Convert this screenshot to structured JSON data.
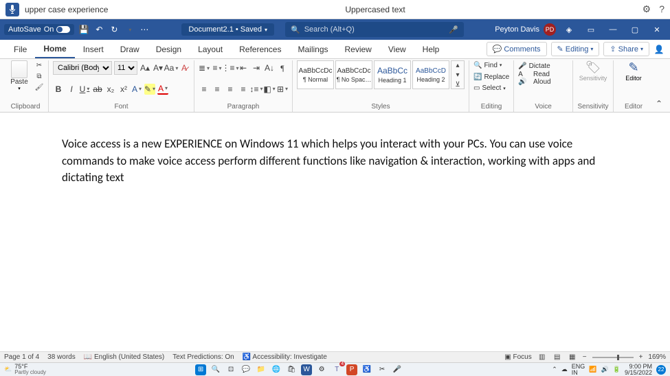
{
  "voice": {
    "command": "upper case experience",
    "feedback": "Uppercased text"
  },
  "titlebar": {
    "autosave_label": "AutoSave",
    "autosave_state": "On",
    "doc_name": "Document2.1 • Saved",
    "search_placeholder": "Search (Alt+Q)",
    "user_name": "Peyton Davis",
    "user_initials": "PD"
  },
  "tabs": {
    "file": "File",
    "home": "Home",
    "insert": "Insert",
    "draw": "Draw",
    "design": "Design",
    "layout": "Layout",
    "references": "References",
    "mailings": "Mailings",
    "review": "Review",
    "view": "View",
    "help": "Help",
    "comments": "Comments",
    "editing": "Editing",
    "share": "Share"
  },
  "ribbon": {
    "paste": "Paste",
    "clipboard": "Clipboard",
    "font_name": "Calibri (Body)",
    "font_size": "11",
    "font_label": "Font",
    "paragraph_label": "Paragraph",
    "styles_label": "Styles",
    "editing_label": "Editing",
    "voice_label": "Voice",
    "sensitivity_label": "Sensitivity",
    "editor_label": "Editor",
    "find": "Find",
    "replace": "Replace",
    "select": "Select",
    "dictate": "Dictate",
    "read_aloud": "Read Aloud",
    "sensitivity_btn": "Sensitivity",
    "editor_btn": "Editor",
    "styles": [
      {
        "sample": "AaBbCcDc",
        "name": "¶ Normal"
      },
      {
        "sample": "AaBbCcDc",
        "name": "¶ No Spac…"
      },
      {
        "sample": "AaBbCc",
        "name": "Heading 1"
      },
      {
        "sample": "AaBbCcD",
        "name": "Heading 2"
      }
    ]
  },
  "document": {
    "body": "Voice access is a new EXPERIENCE on Windows 11 which helps you interact with your PCs. You can use voice commands to make voice access perform different functions like navigation & interaction, working with apps and dictating text"
  },
  "status": {
    "page": "Page 1 of 4",
    "words": "38 words",
    "language": "English (United States)",
    "predictions": "Text Predictions: On",
    "accessibility": "Accessibility: Investigate",
    "focus": "Focus",
    "zoom": "169%"
  },
  "taskbar": {
    "temp": "75°F",
    "weather": "Partly cloudy",
    "lang1": "ENG",
    "lang2": "IN",
    "time": "9:00 PM",
    "date": "9/15/2022",
    "notif_count": "22",
    "teams_badge": "4"
  }
}
